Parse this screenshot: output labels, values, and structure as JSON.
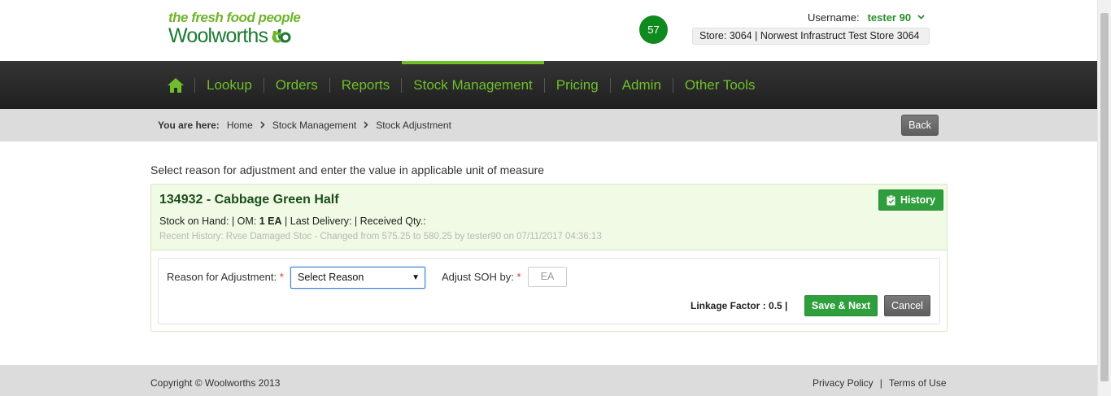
{
  "brand": {
    "tagline": "the fresh food people",
    "name": "Woolworths",
    "color": "#1b7a33",
    "accent": "#6fb52c",
    "logo_icon": "woolworths-w-logo-icon"
  },
  "header": {
    "notification_count": "57",
    "username_label": "Username:",
    "username": "tester 90",
    "store": "Store: 3064 | Norwest Infrastruct Test Store 3064"
  },
  "nav": {
    "home_icon": "home-icon",
    "items": [
      {
        "label": "Lookup"
      },
      {
        "label": "Orders"
      },
      {
        "label": "Reports"
      },
      {
        "label": "Stock Management",
        "active": true
      },
      {
        "label": "Pricing"
      },
      {
        "label": "Admin"
      },
      {
        "label": "Other Tools"
      }
    ]
  },
  "breadcrumb": {
    "lead": "You are here:",
    "items": [
      "Home",
      "Stock Management",
      "Stock Adjustment"
    ],
    "back_label": "Back"
  },
  "main": {
    "intro": "Select reason for adjustment and enter the value in applicable unit of measure",
    "product": {
      "title": "134932 - Cabbage Green Half",
      "soh_prefix": "Stock on Hand: | OM: ",
      "om_value": "1 EA",
      "soh_suffix": " | Last Delivery: | Received Qty.:",
      "recent_history": "Recent History: Rvse Damaged Stoc - Changed from 575.25 to 580.25 by tester90 on 07/11/2017 04:36:13",
      "history_label": "History"
    },
    "form": {
      "reason_label": "Reason for Adjustment:",
      "reason_value": "Select Reason",
      "adjust_label": "Adjust SOH by:",
      "adjust_placeholder": "EA",
      "required_mark": "*",
      "linkage": "Linkage Factor : 0.5 |",
      "save_label": "Save & Next",
      "cancel_label": "Cancel"
    }
  },
  "footer": {
    "copyright": "Copyright © Woolworths 2013",
    "privacy": "Privacy Policy",
    "separator": "|",
    "terms": "Terms of Use"
  }
}
